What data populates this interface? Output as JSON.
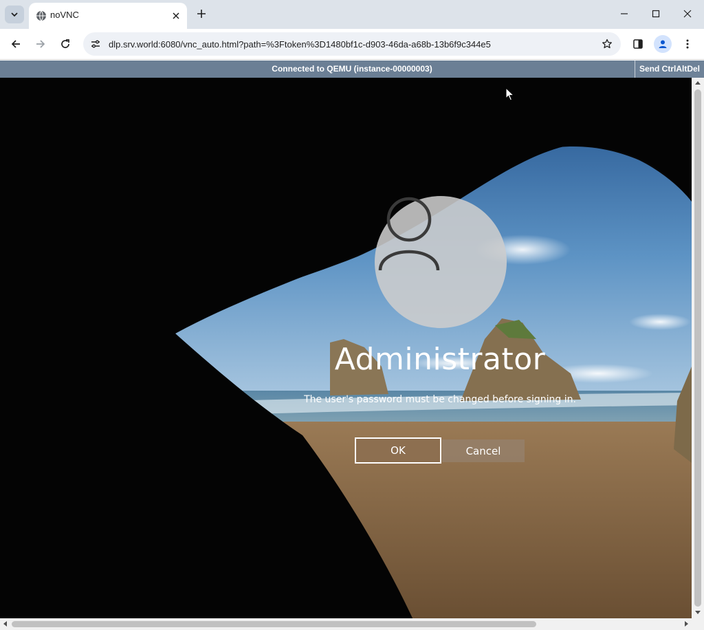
{
  "browser": {
    "tab_title": "noVNC",
    "url": "dlp.srv.world:6080/vnc_auto.html?path=%3Ftoken%3D1480bf1c-d903-46da-a68b-13b6f9c344e5"
  },
  "vnc": {
    "status": "Connected to QEMU (instance-00000003)",
    "send_keys_label": "Send CtrlAltDel"
  },
  "login": {
    "username": "Administrator",
    "message": "The user's password must be changed before signing in.",
    "ok_label": "OK",
    "cancel_label": "Cancel"
  },
  "colors": {
    "vnc_bar": "#6b7f95",
    "tabstrip": "#dde3ea"
  }
}
